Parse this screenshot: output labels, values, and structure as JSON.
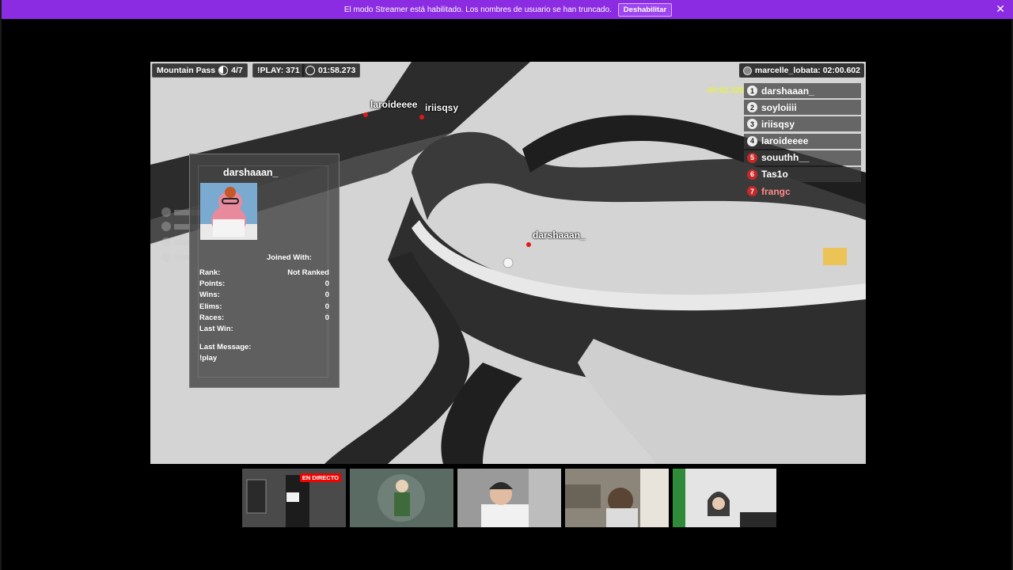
{
  "banner": {
    "message": "El modo Streamer está habilitado. Los nombres de usuario se han truncado.",
    "button_label": "Deshabilitar",
    "close_glyph": "✕",
    "color": "#8b2be2"
  },
  "hud": {
    "track_name": "Mountain Pass",
    "lap": "4/7",
    "play_count": "!PLAY: 371",
    "timer": "01:58.273"
  },
  "record": {
    "label": "marcelle_lobata: 02:00.602"
  },
  "leaderboard": {
    "delta": "-00:02.329",
    "entries": [
      {
        "rank": "1",
        "name": "darshaaan_"
      },
      {
        "rank": "2",
        "name": "soyloiiii"
      },
      {
        "rank": "3",
        "name": "iriisqsy"
      },
      {
        "rank": "4",
        "name": "laroideeee"
      },
      {
        "rank": "5",
        "name": "souuthh__"
      },
      {
        "rank": "6",
        "name": "Tas1o"
      },
      {
        "rank": "7",
        "name": "frangc"
      }
    ]
  },
  "tags": {
    "tag1": "laroideeee",
    "tag2": "iriisqsy",
    "tag3": "darshaaan_"
  },
  "profile": {
    "name": "darshaaan_",
    "joined_with": "Joined With:",
    "stats": [
      {
        "label": "Rank:",
        "value": "Not Ranked"
      },
      {
        "label": "Points:",
        "value": "0"
      },
      {
        "label": "Wins:",
        "value": "0"
      },
      {
        "label": "Elims:",
        "value": "0"
      },
      {
        "label": "Races:",
        "value": "0"
      },
      {
        "label": "Last Win:",
        "value": ""
      }
    ],
    "last_message_label": "Last Message:",
    "last_message": "!play"
  },
  "thumbnails": {
    "live_badge": "EN DIRECTO"
  }
}
